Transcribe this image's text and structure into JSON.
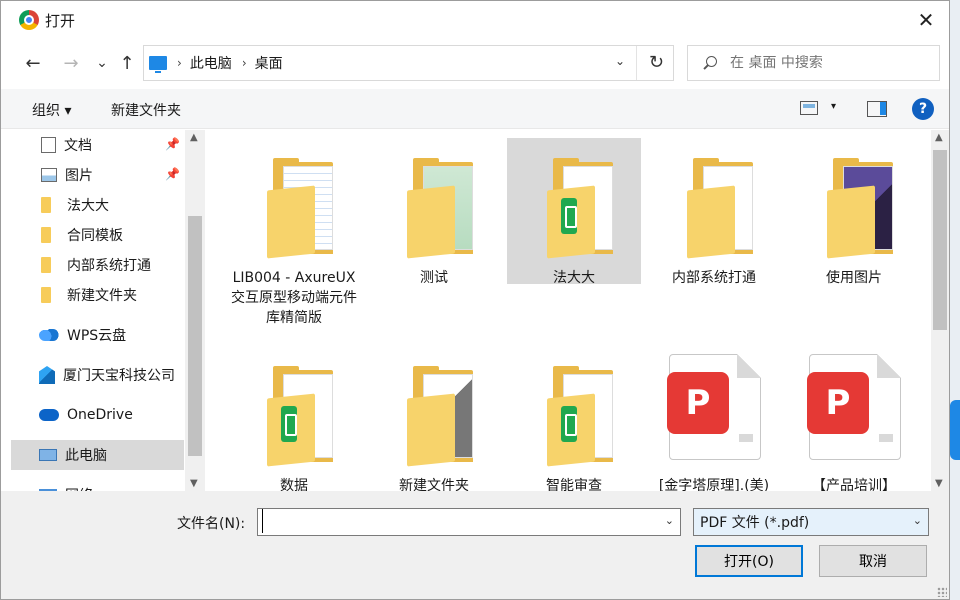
{
  "window": {
    "title": "打开",
    "close_glyph": "✕"
  },
  "nav": {
    "back_glyph": "←",
    "forward_glyph": "→",
    "recent_glyph": "⌄",
    "up_glyph": "↑",
    "breadcrumb": [
      "此电脑",
      "桌面"
    ],
    "breadcrumb_sep": "›",
    "refresh_glyph": "↻",
    "dropdown_glyph": "⌄",
    "search_placeholder": "在 桌面 中搜索"
  },
  "toolbar": {
    "organize": "组织 ▾",
    "new_folder": "新建文件夹",
    "view_drop": "▾",
    "help": "?"
  },
  "sidebar": {
    "items": [
      {
        "label": "文档",
        "icon": "document-icon",
        "pinned": true
      },
      {
        "label": "图片",
        "icon": "picture-icon",
        "pinned": true
      },
      {
        "label": "法大大",
        "icon": "folder-icon",
        "pinned": false
      },
      {
        "label": "合同模板",
        "icon": "folder-icon",
        "pinned": false
      },
      {
        "label": "内部系统打通",
        "icon": "folder-icon",
        "pinned": false
      },
      {
        "label": "新建文件夹",
        "icon": "folder-icon",
        "pinned": false
      },
      {
        "label": "WPS云盘",
        "icon": "wps-cloud-icon",
        "pinned": false
      },
      {
        "label": "厦门天宝科技公司",
        "icon": "company-icon",
        "pinned": false
      },
      {
        "label": "OneDrive",
        "icon": "onedrive-icon",
        "pinned": false
      },
      {
        "label": "此电脑",
        "icon": "computer-icon",
        "pinned": false,
        "selected": true
      },
      {
        "label": "网络",
        "icon": "network-icon",
        "pinned": false
      }
    ],
    "pin_glyph": "📌"
  },
  "files": [
    {
      "name": "LIB004 - AxureUX交互原型移动端元件库精简版",
      "kind": "folder",
      "art": "blue"
    },
    {
      "name": "测试",
      "kind": "folder",
      "art": "green"
    },
    {
      "name": "法大大",
      "kind": "folder-wps",
      "art": "plain",
      "selected": true
    },
    {
      "name": "内部系统打通",
      "kind": "folder",
      "art": "plain"
    },
    {
      "name": "使用图片",
      "kind": "folder",
      "art": "photo"
    },
    {
      "name": "数据",
      "kind": "folder-wps",
      "art": "plain"
    },
    {
      "name": "新建文件夹",
      "kind": "folder",
      "art": "dark"
    },
    {
      "name": "智能审查",
      "kind": "folder-wps",
      "art": "plain"
    },
    {
      "name": "[金字塔原理].(美)",
      "kind": "pdf"
    },
    {
      "name": "【产品培训】",
      "kind": "pdf"
    }
  ],
  "pdf_badge_glyph": "P",
  "footer": {
    "filename_label": "文件名(N):",
    "filename_value": "",
    "filter_value": "PDF 文件 (*.pdf)",
    "open_button": "打开(O)",
    "cancel_button": "取消"
  },
  "scroll_glyphs": {
    "up": "▲",
    "down": "▼"
  }
}
